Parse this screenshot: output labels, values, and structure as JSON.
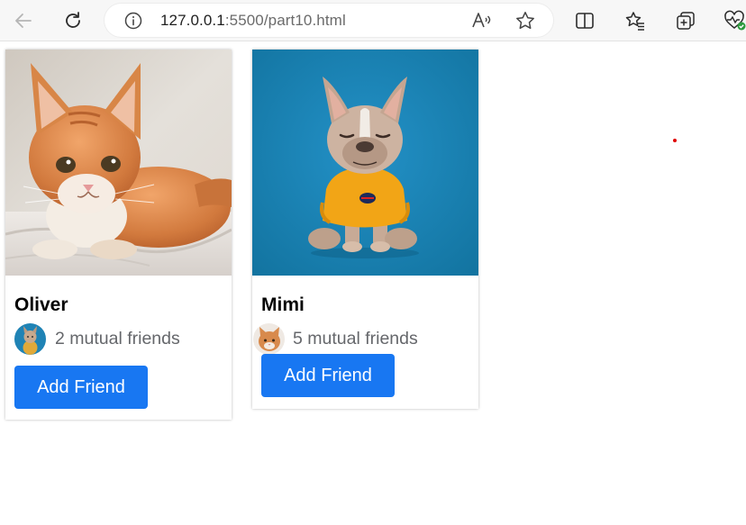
{
  "browser": {
    "url_host": "127.0.0.1",
    "url_rest": ":5500/part10.html"
  },
  "icons": {
    "back": "arrow-left-icon",
    "refresh": "refresh-icon",
    "site_info": "info-icon",
    "read_aloud": "read-aloud-icon",
    "favorite": "star-icon",
    "split_screen": "split-screen-icon",
    "favorites_bar": "favorites-icon",
    "collections": "collections-icon",
    "health": "browser-essentials-icon"
  },
  "colors": {
    "accent": "#1877f2",
    "name_text": "#050505",
    "secondary_text": "#65676b",
    "dog_background": "#1b85b8"
  },
  "cards": [
    {
      "name": "Oliver",
      "mutual_text": "2 mutual friends",
      "button_label": "Add Friend"
    },
    {
      "name": "Mimi",
      "mutual_text": "5 mutual friends",
      "button_label": "Add Friend"
    }
  ]
}
